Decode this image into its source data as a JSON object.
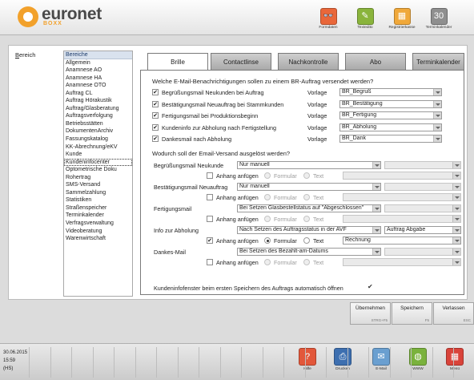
{
  "brand": {
    "name": "euronet",
    "sub": "BOXX"
  },
  "toolbar": [
    {
      "label": "Formdaten",
      "icon": "eyeglasses-icon",
      "glyph": "👓",
      "color": "#e9673a"
    },
    {
      "label": "Textedito",
      "icon": "pencil-icon",
      "glyph": "✎",
      "color": "#8ab43c"
    },
    {
      "label": "Registrierkasse",
      "icon": "cash-register-icon",
      "glyph": "▦",
      "color": "#f0a83a"
    },
    {
      "label": "Terminkalender",
      "icon": "calendar-icon",
      "glyph": "30",
      "color": "#8f8f8f"
    }
  ],
  "sidebar": {
    "label": "Bereich",
    "header": "Bereiche",
    "items": [
      "Allgemein",
      "Anamnese AO",
      "Anamnese HA",
      "Anamnese OTO",
      "Auftrag CL",
      "Auftrag Hörakustik",
      "Auftrag/Glasberatung",
      "Auftragsverfolgung",
      "Betriebsstätten",
      "DokumentenArchiv",
      "Fassungskatalog",
      "KK-Abrechnung/eKV",
      "Kunde",
      "Kundeninfocenter",
      "Optometrische Doku",
      "Rohertrag",
      "SMS-Versand",
      "Sammelzahlung",
      "Statistiken",
      "Straßenspeicher",
      "Terminkalender",
      "Verfragsverwaltung",
      "Videoberatung",
      "Warenwirtschaft"
    ],
    "selected": "Kundeninfocenter"
  },
  "tabs": [
    {
      "label": "Brille",
      "active": true
    },
    {
      "label": "Contactlinse",
      "active": false
    },
    {
      "label": "Nachkontrolle",
      "active": false
    },
    {
      "label": "Abo",
      "active": false
    },
    {
      "label": "Terminkalender",
      "active": false
    }
  ],
  "section1": {
    "title": "Welche E-Mail-Benachrichtigungen sollen zu einem BR-Auftrag versendet werden?",
    "vorlage_label": "Vorlage",
    "rows": [
      {
        "label": "Begrüßungsmail Neukunden bei Auftrag",
        "checked": true,
        "value": "BR_Begruß"
      },
      {
        "label": "Bestätigungsmail Neuauftrag bei Stammkunden",
        "checked": true,
        "value": "BR_Bestätigung"
      },
      {
        "label": "Fertigungsmail bei Produktionsbeginn",
        "checked": true,
        "value": "BR_Fertigung"
      },
      {
        "label": "Kundeninfo zur Abholung nach Fertigstellung",
        "checked": true,
        "value": "BR_Abholung"
      },
      {
        "label": "Dankesmail nach Abholung",
        "checked": true,
        "value": "BR_Dank"
      }
    ]
  },
  "section2": {
    "title": "Wodurch soll der Email-Versand ausgelöst werden?",
    "anhang_label": "Anhang anfügen",
    "formular_label": "Formular",
    "text_label": "Text",
    "rows": [
      {
        "label": "Begrüßungsmail Neukunde",
        "trigger": "Nur manuell",
        "extra": "",
        "anhang": false,
        "mode": "",
        "text_value": ""
      },
      {
        "label": "Bestätigungsmail Neuauftrag",
        "trigger": "Nur manuell",
        "extra": "",
        "anhang": false,
        "mode": "",
        "text_value": ""
      },
      {
        "label": "Fertigungsmail",
        "trigger": "Bei Setzen Glasbestellstatus auf \"Abgeschlossen\"",
        "extra": "",
        "anhang": false,
        "mode": "",
        "text_value": ""
      },
      {
        "label": "Info zur Abholung",
        "trigger": "Nach Setzen des Auftragsstatus in der AVF",
        "extra": "Auftrag Abgabe",
        "anhang": true,
        "mode": "Formular",
        "text_value": "Rechnung"
      },
      {
        "label": "Dankes-Mail",
        "trigger": "Bei Setzen des Bezahlt-am-Datums",
        "extra": "",
        "anhang": false,
        "mode": "",
        "text_value": ""
      }
    ]
  },
  "footer_option": {
    "label": "Kundeninfofenster beim ersten Speichern des Auftrags automatisch öffnen",
    "checked": true
  },
  "actions": [
    {
      "label": "Übernehmen",
      "shortcut": "STRG+F5"
    },
    {
      "label": "Speichern",
      "shortcut": "F5"
    },
    {
      "label": "Verlassen",
      "shortcut": "ESC"
    }
  ],
  "status": {
    "date": "30.06.2015",
    "time": "15:59",
    "dialect": "(HS)"
  },
  "bottom_tools": [
    {
      "label": "Hilfe",
      "icon": "help-icon",
      "glyph": "?",
      "color": "#e2573a"
    },
    {
      "label": "Drucken",
      "icon": "printer-icon",
      "glyph": "⎙",
      "color": "#3d6fb0"
    },
    {
      "label": "E-Mail",
      "icon": "mail-icon",
      "glyph": "✉",
      "color": "#6a9fd0"
    },
    {
      "label": "WWW",
      "icon": "globe-icon",
      "glyph": "◍",
      "color": "#7ab23d"
    },
    {
      "label": "Menü",
      "icon": "menu-grid-icon",
      "glyph": "▦",
      "color": "#d9433a"
    }
  ]
}
